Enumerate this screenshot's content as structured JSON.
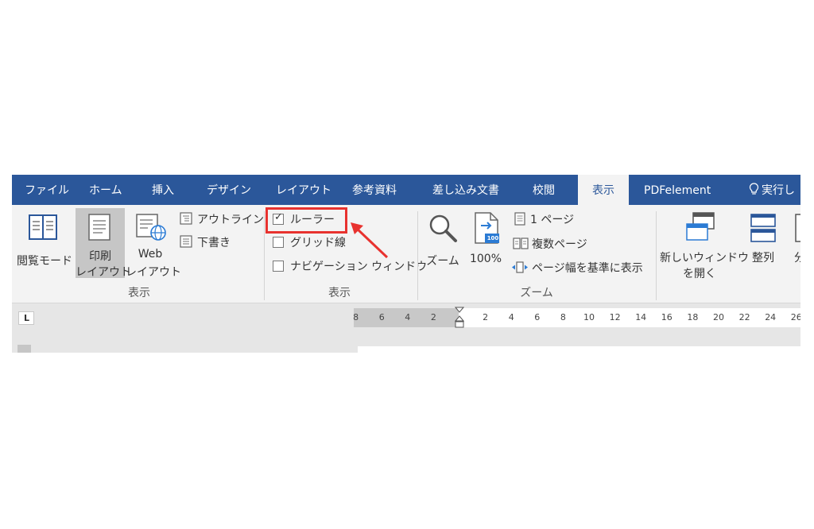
{
  "tabs": {
    "file": "ファイル",
    "home": "ホーム",
    "insert": "挿入",
    "design": "デザイン",
    "layout": "レイアウト",
    "references": "参考資料",
    "mailings": "差し込み文書",
    "review": "校閲",
    "view": "表示",
    "pdfelement": "PDFelement",
    "tell_me": "実行し"
  },
  "ribbon": {
    "views_group": {
      "label": "表示",
      "read_mode": "閲覧モード",
      "print_layout_line1": "印刷",
      "print_layout_line2": "レイアウト",
      "web_layout_line1": "Web",
      "web_layout_line2": "レイアウト",
      "outline": "アウトライン",
      "draft": "下書き"
    },
    "show_group": {
      "label": "表示",
      "ruler": "ルーラー",
      "ruler_checked": true,
      "gridlines": "グリッド線",
      "gridlines_checked": false,
      "nav_pane": "ナビゲーション ウィンドウ",
      "nav_pane_checked": false
    },
    "zoom_group": {
      "label": "ズーム",
      "zoom": "ズーム",
      "zoom_100": "100%",
      "zoom_100_badge": "100",
      "one_page": "1 ページ",
      "multiple_pages": "複数ページ",
      "page_width": "ページ幅を基準に表示"
    },
    "window_group": {
      "new_window_line1": "新しいウィンドウ",
      "new_window_line2": "を開く",
      "arrange_all": "整列",
      "split_partial": "分"
    }
  },
  "ruler": {
    "corner_glyph": "L",
    "left_numbers": [
      "8",
      "6",
      "4",
      "2"
    ],
    "right_numbers": [
      "2",
      "4",
      "6",
      "8",
      "10",
      "12",
      "14",
      "16",
      "18",
      "20",
      "22",
      "24",
      "26"
    ]
  },
  "colors": {
    "tab_bar": "#2b579a",
    "highlight": "#e8322f",
    "ribbon_bg": "#f3f3f3"
  }
}
